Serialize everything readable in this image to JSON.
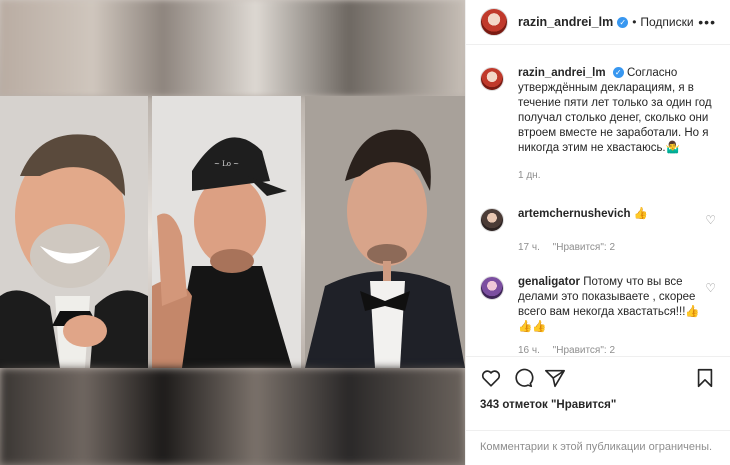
{
  "post": {
    "author": "razin_andrei_lm",
    "follow_label": "Подписки",
    "dot": "•",
    "more": "•••",
    "verified_glyph": "✓"
  },
  "caption": {
    "author": "razin_andrei_lm",
    "text": "Согласно утверждённым декларациям, я в течение пяти лет только за один год получал столько денег, сколько они втроем вместе не заработали. Но я никогда этим не хвастаюсь.🤷‍♂️",
    "time": "1 дн."
  },
  "comments": [
    {
      "author": "artemchernushevich",
      "text": "👍",
      "time": "17 ч.",
      "likes": "\"Нравится\": 2"
    },
    {
      "author": "genaligator",
      "text": "Потому что вы все делами это показываете , скорее всего вам некогда хвастаться!!!👍👍👍",
      "time": "16 ч.",
      "likes": "\"Нравится\": 2"
    }
  ],
  "actions": {
    "likes_text": "343 отметок \"Нравится\""
  },
  "footer": {
    "text": "Комментарии к этой публикации ограничены."
  },
  "colors": {
    "verified": "#3897f0",
    "muted": "#8e8e8e",
    "text": "#262626"
  }
}
